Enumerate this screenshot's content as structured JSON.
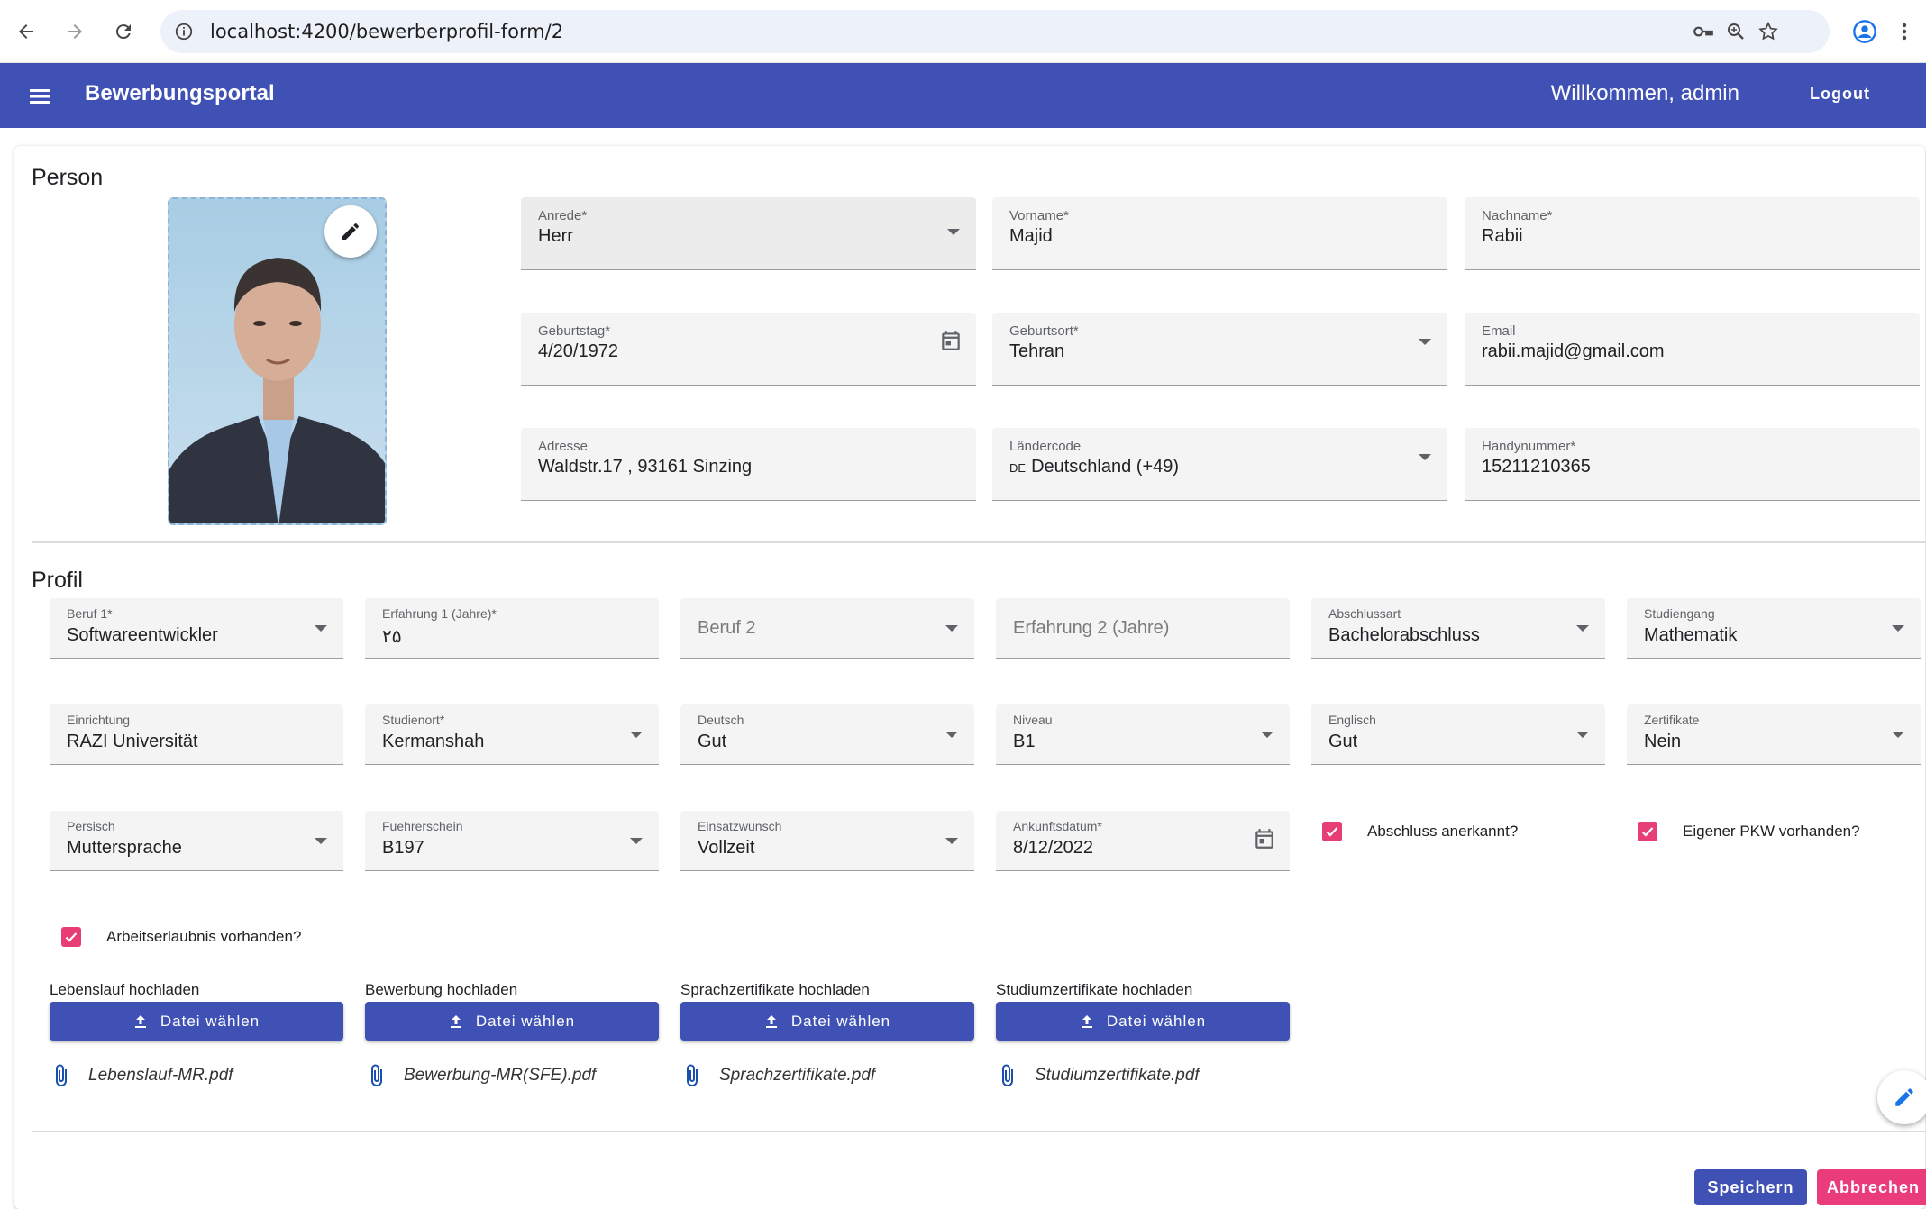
{
  "browser": {
    "url": "localhost:4200/bewerberprofil-form/2"
  },
  "header": {
    "title": "Bewerbungsportal",
    "welcome": "Willkommen, admin",
    "logout": "Logout",
    "color": "#3f51b5"
  },
  "person": {
    "title": "Person",
    "fields": {
      "anrede": {
        "label": "Anrede*",
        "value": "Herr"
      },
      "vorname": {
        "label": "Vorname*",
        "value": "Majid"
      },
      "nachname": {
        "label": "Nachname*",
        "value": "Rabii"
      },
      "geburtstag": {
        "label": "Geburtstag*",
        "value": "4/20/1972"
      },
      "geburtsort": {
        "label": "Geburtsort*",
        "value": "Tehran"
      },
      "email": {
        "label": "Email",
        "value": "rabii.majid@gmail.com"
      },
      "adresse": {
        "label": "Adresse",
        "value": "Waldstr.17 , 93161 Sinzing"
      },
      "laendercode": {
        "label": "Ländercode",
        "flag": "DE",
        "value": "Deutschland (+49)"
      },
      "handynummer": {
        "label": "Handynummer*",
        "value": "15211210365"
      }
    }
  },
  "profil": {
    "title": "Profil",
    "fields": {
      "beruf1": {
        "label": "Beruf 1*",
        "value": "Softwareentwickler"
      },
      "erfahrung1": {
        "label": "Erfahrung 1 (Jahre)*",
        "value": "۲۵"
      },
      "beruf2": {
        "placeholder": "Beruf 2"
      },
      "erfahrung2": {
        "placeholder": "Erfahrung 2 (Jahre)"
      },
      "abschlussart": {
        "label": "Abschlussart",
        "value": "Bachelorabschluss"
      },
      "studiengang": {
        "label": "Studiengang",
        "value": "Mathematik"
      },
      "einrichtung": {
        "label": "Einrichtung",
        "value": "RAZI Universität"
      },
      "studienort": {
        "label": "Studienort*",
        "value": "Kermanshah"
      },
      "deutsch": {
        "label": "Deutsch",
        "value": "Gut"
      },
      "niveau": {
        "label": "Niveau",
        "value": "B1"
      },
      "englisch": {
        "label": "Englisch",
        "value": "Gut"
      },
      "zertifikate": {
        "label": "Zertifikate",
        "value": "Nein"
      },
      "persisch": {
        "label": "Persisch",
        "value": "Muttersprache"
      },
      "fuehrerschein": {
        "label": "Fuehrerschein",
        "value": "B197"
      },
      "einsatzwunsch": {
        "label": "Einsatzwunsch",
        "value": "Vollzeit"
      },
      "ankunftsdatum": {
        "label": "Ankunftsdatum*",
        "value": "8/12/2022"
      }
    },
    "checkboxes": {
      "abschluss": {
        "label": "Abschluss anerkannt?",
        "checked": true
      },
      "pkw": {
        "label": "Eigener PKW vorhanden?",
        "checked": true
      },
      "arbeitserlaubnis": {
        "label": "Arbeitserlaubnis vorhanden?",
        "checked": true
      }
    },
    "uploads": [
      {
        "label": "Lebenslauf hochladen",
        "button": "Datei wählen",
        "file": "Lebenslauf-MR.pdf"
      },
      {
        "label": "Bewerbung hochladen",
        "button": "Datei wählen",
        "file": "Bewerbung-MR(SFE).pdf"
      },
      {
        "label": "Sprachzertifikate hochladen",
        "button": "Datei wählen",
        "file": "Sprachzertifikate.pdf"
      },
      {
        "label": "Studiumzertifikate hochladen",
        "button": "Datei wählen",
        "file": "Studiumzertifikate.pdf"
      }
    ]
  },
  "actions": {
    "save": "Speichern",
    "cancel": "Abbrechen"
  }
}
